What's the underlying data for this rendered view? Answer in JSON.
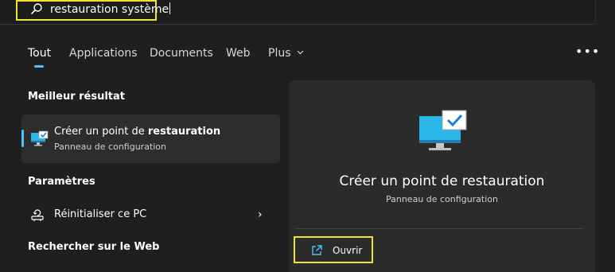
{
  "search": {
    "query": "restauration système",
    "icon": "search-icon",
    "highlight_color": "#f3e22d"
  },
  "tabs": [
    {
      "label": "Tout",
      "active": true
    },
    {
      "label": "Applications",
      "active": false
    },
    {
      "label": "Documents",
      "active": false
    },
    {
      "label": "Web",
      "active": false
    },
    {
      "label": "Plus",
      "active": false,
      "icon": "chevron-down-icon"
    }
  ],
  "more_options_icon": "more-options-icon",
  "best_match": {
    "section_title": "Meilleur résultat",
    "title_prefix": "Créer un point de ",
    "title_bold": "restauration",
    "subtitle": "Panneau de configuration",
    "icon": "monitor-check-icon"
  },
  "settings": {
    "section_title": "Paramètres",
    "items": [
      {
        "label": "Réinitialiser ce PC",
        "icon": "reset-pc-icon",
        "chevron": "›"
      }
    ]
  },
  "web_search": {
    "section_title": "Rechercher sur le Web"
  },
  "detail": {
    "title": "Créer un point de restauration",
    "subtitle": "Panneau de configuration",
    "icon": "monitor-check-icon",
    "actions": [
      {
        "label": "Ouvrir",
        "icon": "open-external-icon"
      }
    ]
  },
  "colors": {
    "background": "#1f1f1f",
    "panel": "#2b2b2b",
    "selected_item": "#2d2d2d",
    "accent": "#4cc2ff",
    "highlight": "#f3e22d"
  }
}
